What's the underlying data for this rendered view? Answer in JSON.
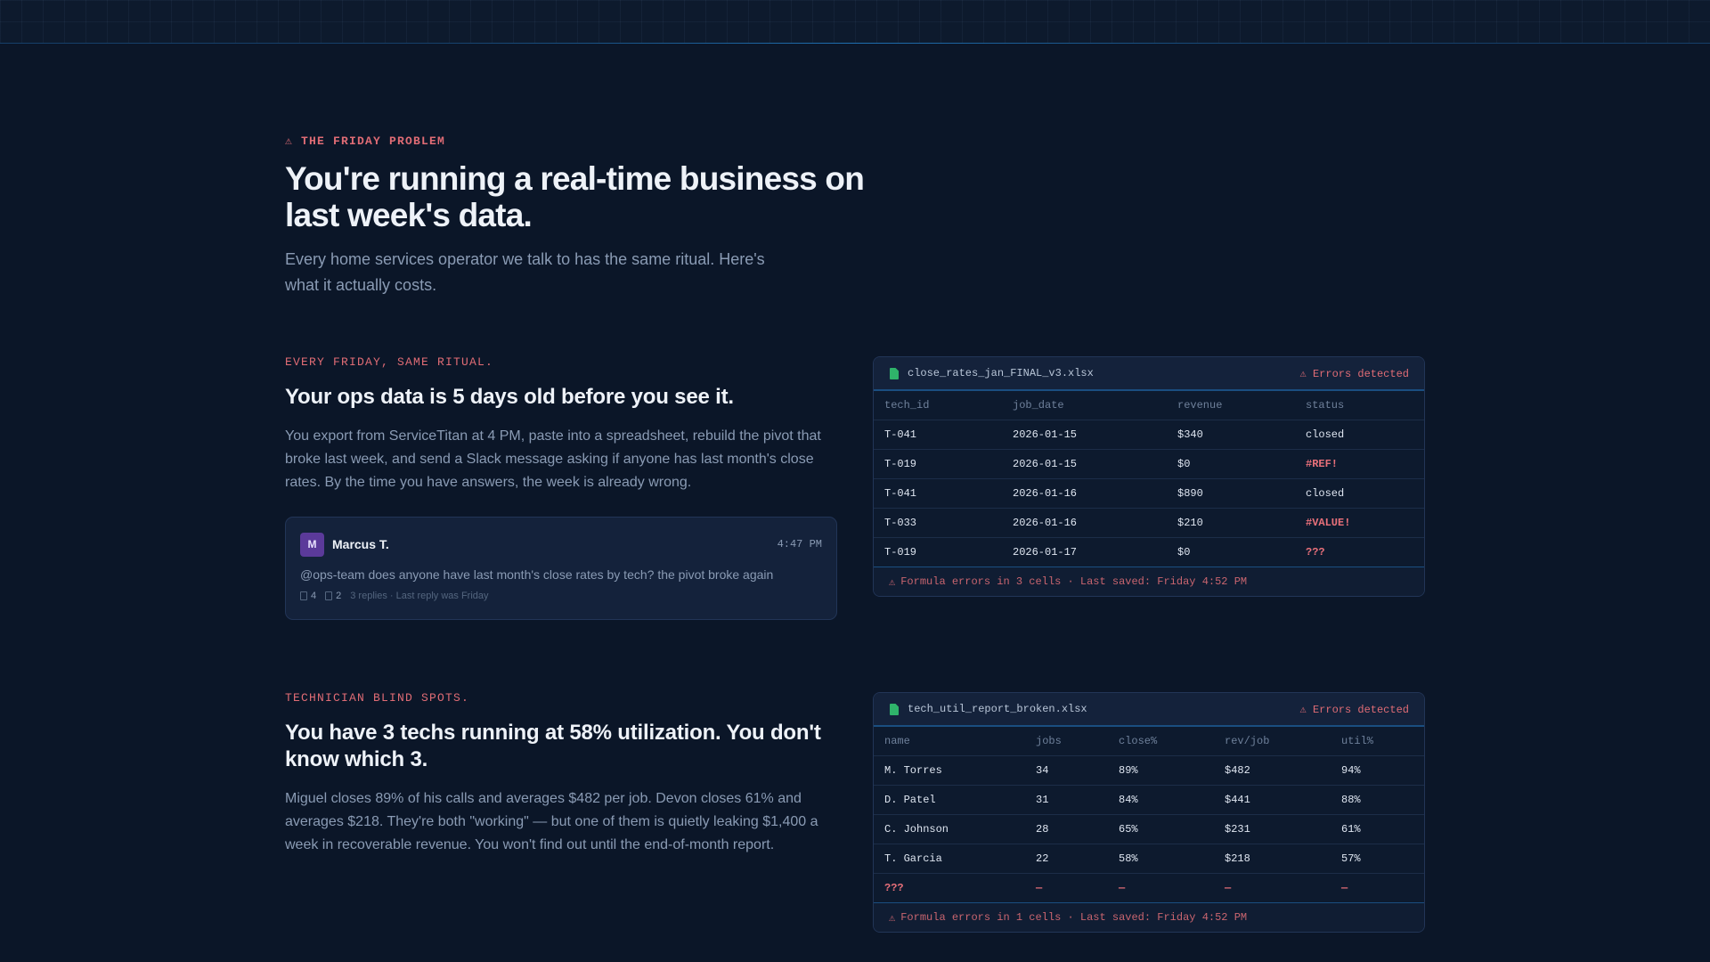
{
  "hero": {
    "eyebrow": "⚠ THE FRIDAY PROBLEM",
    "title": "You're running a real-time business on last week's data.",
    "subtitle": "Every home services operator we talk to has the same ritual. Here's what it actually costs."
  },
  "section1": {
    "eyebrow": "EVERY FRIDAY, SAME RITUAL.",
    "title": "Your ops data is 5 days old before you see it.",
    "body": "You export from ServiceTitan at 4 PM, paste into a spreadsheet, rebuild the pivot that broke last week, and send a Slack message asking if anyone has last month's close rates. By the time you have answers, the week is already wrong."
  },
  "slack": {
    "avatar_initial": "M",
    "name": "Marcus T.",
    "time": "4:47 PM",
    "message": "@ops-team does anyone have last month's close rates by tech? the pivot broke again",
    "reaction_count": "4",
    "comment_count": "2",
    "meta": "3 replies · Last reply was Friday"
  },
  "sheet1": {
    "filename": "close_rates_jan_FINAL_v3.xlsx",
    "badge": "⚠ Errors detected",
    "columns": [
      "tech_id",
      "job_date",
      "revenue",
      "status"
    ],
    "rows": [
      [
        "T-041",
        "2026-01-15",
        "$340",
        "closed"
      ],
      [
        "T-019",
        "2026-01-15",
        "$0",
        "#REF!"
      ],
      [
        "T-041",
        "2026-01-16",
        "$890",
        "closed"
      ],
      [
        "T-033",
        "2026-01-16",
        "$210",
        "#VALUE!"
      ],
      [
        "T-019",
        "2026-01-17",
        "$0",
        "???"
      ]
    ],
    "footer": "Formula errors in 3 cells · Last saved: Friday 4:52 PM"
  },
  "section2": {
    "eyebrow": "TECHNICIAN BLIND SPOTS.",
    "title": "You have 3 techs running at 58% utilization. You don't know which 3.",
    "body": "Miguel closes 89% of his calls and averages $482 per job. Devon closes 61% and averages $218. They're both \"working\" — but one of them is quietly leaking $1,400 a week in recoverable revenue. You won't find out until the end-of-month report."
  },
  "sheet2": {
    "filename": "tech_util_report_broken.xlsx",
    "badge": "⚠ Errors detected",
    "columns": [
      "name",
      "jobs",
      "close%",
      "rev/job",
      "util%"
    ],
    "rows": [
      [
        "M. Torres",
        "34",
        "89%",
        "$482",
        "94%"
      ],
      [
        "D. Patel",
        "31",
        "84%",
        "$441",
        "88%"
      ],
      [
        "C. Johnson",
        "28",
        "65%",
        "$231",
        "61%"
      ],
      [
        "T. Garcia",
        "22",
        "58%",
        "$218",
        "57%"
      ],
      [
        "???",
        "—",
        "—",
        "—",
        "—"
      ]
    ],
    "footer": "Formula errors in 1 cells · Last saved: Friday 4:52 PM"
  },
  "colors": {
    "background": "#0b1628",
    "accent_red": "#e06c75",
    "file_icon_green": "#2fb36a",
    "avatar_purple": "#5b3a9a"
  },
  "icons": {
    "warning": "warning-triangle-icon",
    "file": "spreadsheet-file-icon",
    "reaction": "emoji-reaction-icon",
    "comment": "comment-icon"
  }
}
